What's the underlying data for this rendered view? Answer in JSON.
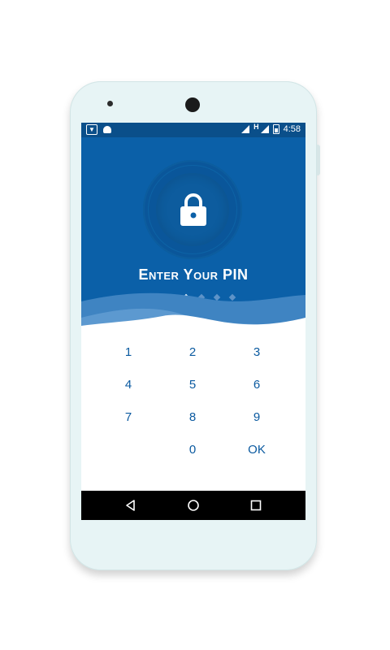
{
  "status_bar": {
    "left_icons": [
      "app-notification-icon",
      "android-icon"
    ],
    "network_type": "H",
    "time": "4:58"
  },
  "lock_screen": {
    "title": "Enter Your PIN",
    "pin_length": 6,
    "pin_entered": 3
  },
  "keypad": {
    "keys": [
      "1",
      "2",
      "3",
      "4",
      "5",
      "6",
      "7",
      "8",
      "9",
      "0",
      "OK"
    ]
  },
  "navigation": {
    "buttons": [
      "back",
      "home",
      "recents"
    ]
  },
  "colors": {
    "primary": "#0b60a8",
    "statusbar": "#0a4f8a",
    "key_text": "#0b5aa0",
    "device_body": "#e7f4f5"
  }
}
